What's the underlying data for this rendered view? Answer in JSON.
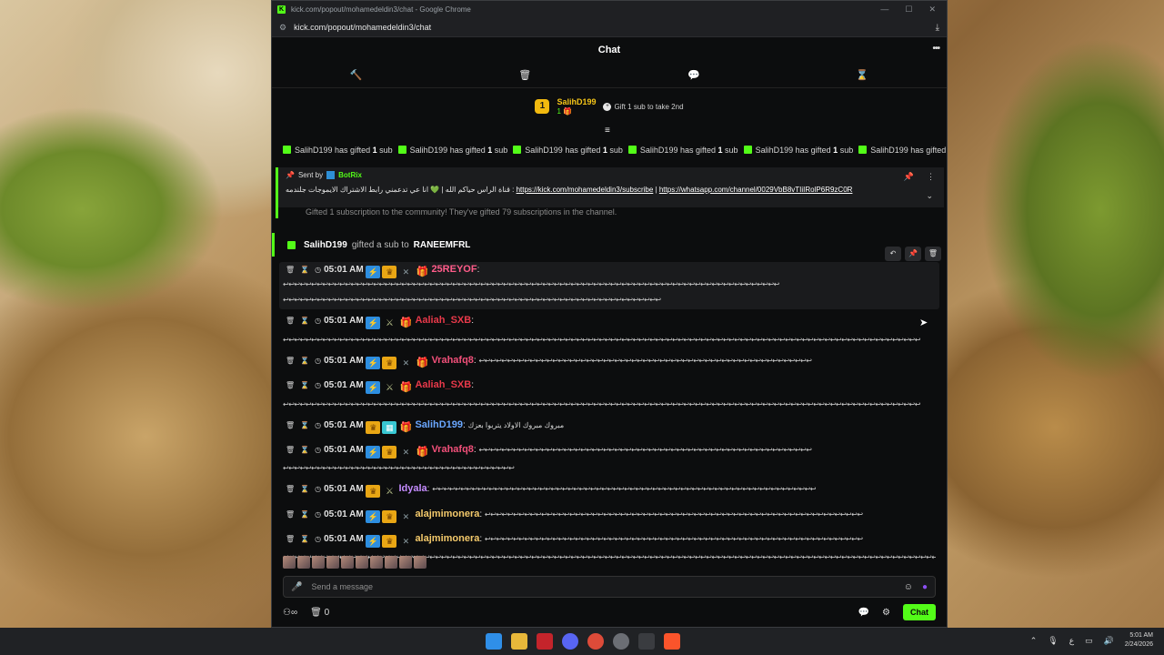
{
  "window": {
    "title": "kick.com/popout/mohamedeldin3/chat - Google Chrome",
    "url": "kick.com/popout/mohamedeldin3/chat",
    "controls": [
      "—",
      "☐",
      "✕"
    ]
  },
  "chat": {
    "header_title": "Chat",
    "leaderboard": {
      "rank": "1",
      "name": "SalihD199",
      "subs": "1",
      "gift_cta": "Gift 1 sub to take 2nd"
    },
    "ticker": [
      {
        "user": "SalihD199",
        "text": "has gifted",
        "count": "1",
        "unit": "sub"
      },
      {
        "user": "SalihD199",
        "text": "has gifted",
        "count": "1",
        "unit": "sub"
      },
      {
        "user": "SalihD199",
        "text": "has gifted",
        "count": "1",
        "unit": "sub"
      },
      {
        "user": "SalihD199",
        "text": "has gifted",
        "count": "1",
        "unit": "sub"
      },
      {
        "user": "SalihD199",
        "text": "has gifted",
        "count": "1",
        "unit": "sub"
      },
      {
        "user": "SalihD199",
        "text": "has gifted",
        "count": "1",
        "unit": "sub"
      }
    ],
    "pinned": {
      "sent_by_label": "Sent by",
      "sender": "BotRix",
      "arabic_text": "قناة الراس حياكم الله | 💚 انا عي تدعمني رابط الاشتراك الايموجات جلندمه",
      "link1": "https://kick.com/mohamedeldin3/subscribe",
      "sep": "|",
      "link2": "https://whatsapp.com/channel/0029VbB8vTIiIRolP6R9zC0R"
    },
    "community_line": "Gifted 1 subscription to the community! They've gifted 79 subscriptions in the channel.",
    "gift_event": {
      "user": "SalihD199",
      "text": "gifted a sub to",
      "recipient": "RANEEMFRL"
    },
    "messages": [
      {
        "time": "05:01 AM",
        "user": "25REYOF",
        "color": "#ff5c8a",
        "badges": [
          "blue",
          "crown",
          "x",
          "gift-pink"
        ],
        "text": "↩↩↩↩↩↩↩↩↩↩↩↩↩↩↩↩↩↩↩↩↩↩↩↩↩↩↩↩↩↩↩↩↩↩↩↩↩↩↩↩↩↩↩↩↩↩↩↩↩↩↩↩↩↩↩↩↩↩↩↩↩↩↩↩↩↩↩↩↩↩↩↩↩↩↩↩↩↩↩↩↩↩↩↩↩↩↩↩",
        "cont": "↩↩↩↩↩↩↩↩↩↩↩↩↩↩↩↩↩↩↩↩↩↩↩↩↩↩↩↩↩↩↩↩↩↩↩↩↩↩↩↩↩↩↩↩↩↩↩↩↩↩↩↩↩↩↩↩↩↩↩↩↩↩↩↩↩↩↩"
      },
      {
        "time": "05:01 AM",
        "user": "Aaliah_SXB",
        "color": "#e8394a",
        "badges": [
          "blue",
          "sword",
          "gift"
        ],
        "text": "",
        "cont": "↩↩↩↩↩↩↩↩↩↩↩↩↩↩↩↩↩↩↩↩↩↩↩↩↩↩↩↩↩↩↩↩↩↩↩↩↩↩↩↩↩↩↩↩↩↩↩↩↩↩↩↩↩↩↩↩↩↩↩↩↩↩↩↩↩↩↩↩↩↩↩↩↩↩↩↩↩↩↩↩↩↩↩↩↩↩↩↩↩↩↩↩↩↩↩↩↩↩↩↩↩↩↩↩↩↩↩↩↩↩↩↩↩"
      },
      {
        "time": "05:01 AM",
        "user": "Vrahafq8",
        "color": "#f2507a",
        "badges": [
          "blue",
          "crown",
          "x",
          "gift-purple"
        ],
        "text": "↩↩↩↩↩↩↩↩↩↩↩↩↩↩↩↩↩↩↩↩↩↩↩↩↩↩↩↩↩↩↩↩↩↩↩↩↩↩↩↩↩↩↩↩↩↩↩↩↩↩↩↩↩↩↩↩↩↩↩",
        "cont": ""
      },
      {
        "time": "05:01 AM",
        "user": "Aaliah_SXB",
        "color": "#e8394a",
        "badges": [
          "blue",
          "sword",
          "gift"
        ],
        "text": "",
        "cont": "↩↩↩↩↩↩↩↩↩↩↩↩↩↩↩↩↩↩↩↩↩↩↩↩↩↩↩↩↩↩↩↩↩↩↩↩↩↩↩↩↩↩↩↩↩↩↩↩↩↩↩↩↩↩↩↩↩↩↩↩↩↩↩↩↩↩↩↩↩↩↩↩↩↩↩↩↩↩↩↩↩↩↩↩↩↩↩↩↩↩↩↩↩↩↩↩↩↩↩↩↩↩↩↩↩↩↩↩↩↩↩↩↩"
      },
      {
        "time": "05:01 AM",
        "user": "SalihD199",
        "color": "#6aa7ff",
        "badges": [
          "crown",
          "cyan",
          "gift-gold"
        ],
        "text": "مبروك مبروك الاولاد يتربوا بعزك",
        "cont": ""
      },
      {
        "time": "05:01 AM",
        "user": "Vrahafq8",
        "color": "#f2507a",
        "badges": [
          "blue",
          "crown",
          "x",
          "gift-purple"
        ],
        "text": "↩↩↩↩↩↩↩↩↩↩↩↩↩↩↩↩↩↩↩↩↩↩↩↩↩↩↩↩↩↩↩↩↩↩↩↩↩↩↩↩↩↩↩↩↩↩↩↩↩↩↩↩↩↩↩↩↩↩↩",
        "cont": "↩↩↩↩↩↩↩↩↩↩↩↩↩↩↩↩↩↩↩↩↩↩↩↩↩↩↩↩↩↩↩↩↩↩↩↩↩↩↩↩↩"
      },
      {
        "time": "05:01 AM",
        "user": "Idyala",
        "color": "#c58cff",
        "badges": [
          "crown",
          "sword"
        ],
        "text": "↩↩↩↩↩↩↩↩↩↩↩↩↩↩↩↩↩↩↩↩↩↩↩↩↩↩↩↩↩↩↩↩↩↩↩↩↩↩↩↩↩↩↩↩↩↩↩↩↩↩↩↩↩↩↩↩↩↩↩↩↩↩↩↩↩↩↩↩",
        "cont": ""
      },
      {
        "time": "05:01 AM",
        "user": "alajmimonera",
        "color": "#f3c96b",
        "badges": [
          "blue",
          "crown",
          "x"
        ],
        "text": "↩↩↩↩↩↩↩↩↩↩↩↩↩↩↩↩↩↩↩↩↩↩↩↩↩↩↩↩↩↩↩↩↩↩↩↩↩↩↩↩↩↩↩↩↩↩↩↩↩↩↩↩↩↩↩↩↩↩↩↩↩↩↩↩↩↩↩",
        "cont": ""
      },
      {
        "time": "05:01 AM",
        "user": "alajmimonera",
        "color": "#f3c96b",
        "badges": [
          "blue",
          "crown",
          "x"
        ],
        "text": "↩↩↩↩↩↩↩↩↩↩↩↩↩↩↩↩↩↩↩↩↩↩↩↩↩↩↩↩↩↩↩↩↩↩↩↩↩↩↩↩↩↩↩↩↩↩↩↩↩↩↩↩↩↩↩↩↩↩↩↩↩↩↩↩↩↩↩",
        "cont": "↩↩↩↩↩↩↩↩↩↩↩↩↩↩↩↩↩↩↩↩↩↩↩↩↩↩↩↩↩↩↩↩↩↩↩↩↩↩↩↩↩↩↩↩↩↩↩↩↩↩↩↩↩↩↩↩↩↩↩↩↩↩↩↩↩↩↩↩↩↩↩↩↩↩↩↩↩↩↩↩↩↩↩↩↩↩↩↩↩↩↩↩↩↩↩↩↩↩↩↩↩↩↩↩↩↩↩↩↩↩↩↩↩↩↩↩↩↩↩↩↩↩↩↩↩↩↩↩↩↩↩↩↩↩↩↩↩↩↩↩↩↩↩↩↩↩↩↩↩↩↩↩↩↩↩↩↩↩↩↩↩↩↩↩↩↩↩↩↩↩↩↩↩↩↩↩↩↩↩↩↩↩↩↩↩↩↩↩↩↩↩↩↩↩↩↩↩↩↩↩↩↩↩↩↩↩↩↩↩↩↩↩↩↩↩↩↩↩↩↩↩↩↩↩↩↩↩↩↩↩↩"
      }
    ],
    "input_placeholder": "Send a message",
    "bottom": {
      "count": "0",
      "send_label": "Chat"
    }
  },
  "taskbar": {
    "lang": "ع",
    "time": "5:01 AM",
    "date": "2/24/2026"
  },
  "colors": {
    "accent": "#53fc18",
    "bg": "#0c0d0e"
  }
}
